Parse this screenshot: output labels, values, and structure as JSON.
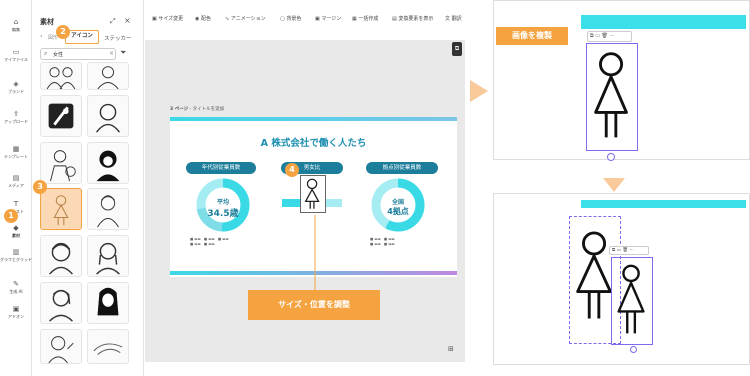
{
  "rail": {
    "items": [
      {
        "icon": "⌂",
        "label": "編集"
      },
      {
        "icon": "▭",
        "label": "マイファイル"
      },
      {
        "icon": "◈",
        "label": "ブランド"
      },
      {
        "icon": "⇪",
        "label": "アップロード"
      },
      {
        "icon": "▦",
        "label": "テンプレート"
      },
      {
        "icon": "▤",
        "label": "メディア"
      },
      {
        "icon": "T",
        "label": "テキスト"
      },
      {
        "icon": "◆",
        "label": "素材"
      },
      {
        "icon": "▥",
        "label": "グラフとグリッド"
      },
      {
        "icon": "✎",
        "label": "生成 AI"
      },
      {
        "icon": "▣",
        "label": "アドオン"
      }
    ]
  },
  "panel": {
    "title": "素材",
    "tabs": [
      "図形",
      "アイコン",
      "ステッカー"
    ],
    "search_value": "女性"
  },
  "toolbar": {
    "items": [
      "サイズ変更",
      "配色",
      "アニメーション",
      "背景色",
      "マージン",
      "一括作成",
      "変換要素を表示",
      "翻訳"
    ]
  },
  "slide": {
    "page_label": "3 ページ",
    "page_title_placeholder": "タイトルを追加",
    "title": "A 株式会社で働く人たち",
    "left": {
      "heading": "年代別従業員数",
      "center_top": "平均",
      "center_bottom": "34.5歳"
    },
    "middle": {
      "heading": "男女比"
    },
    "right": {
      "heading": "拠点別従業員数",
      "center_top": "全国",
      "center_bottom": "4拠点"
    }
  },
  "steps": [
    "1",
    "2",
    "3",
    "4"
  ],
  "callouts": {
    "resize": "サイズ・位置を調整",
    "duplicate": "画像を複製"
  },
  "colors": {
    "accent": "#f4a340",
    "teal": "#1d7e9c",
    "cyan": "#3ad9e6",
    "light_cyan": "#a6ecf3"
  }
}
